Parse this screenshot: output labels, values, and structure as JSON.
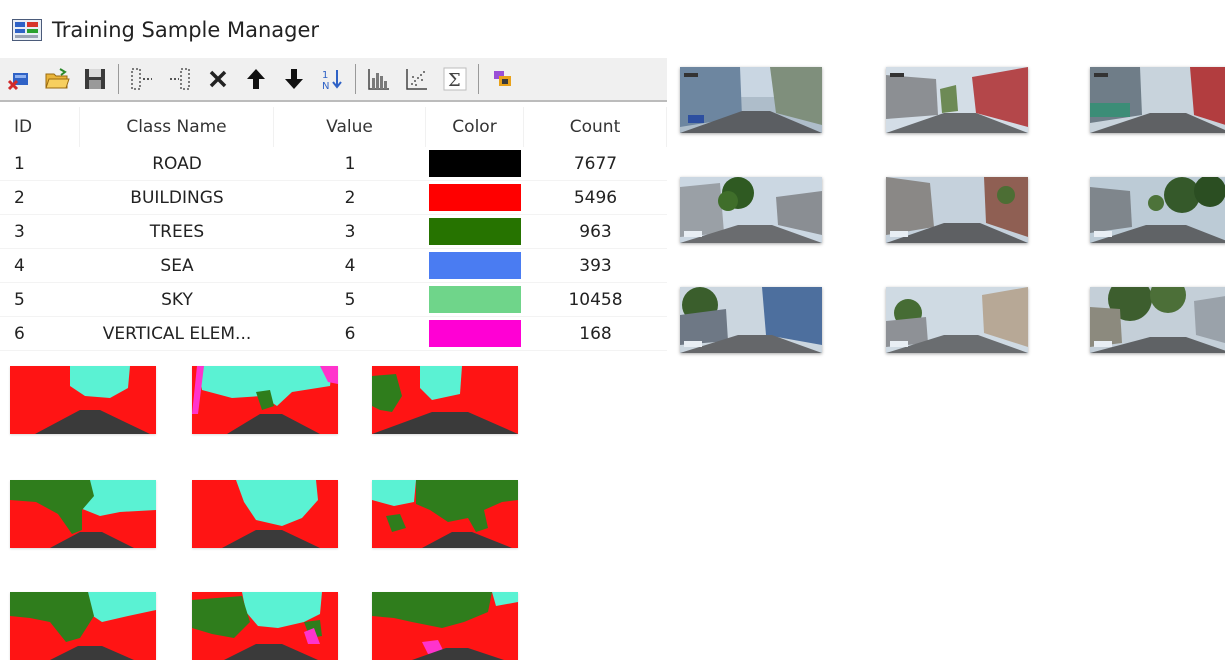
{
  "window": {
    "title": "Training Sample Manager",
    "icon": "training-sample-manager-icon"
  },
  "toolbar": {
    "buttons": [
      {
        "name": "new-class-icon"
      },
      {
        "name": "open-folder-icon"
      },
      {
        "name": "save-icon"
      },
      {
        "name": "separator"
      },
      {
        "name": "merge-classes-icon"
      },
      {
        "name": "split-class-icon"
      },
      {
        "name": "delete-icon"
      },
      {
        "name": "move-up-icon"
      },
      {
        "name": "move-down-icon"
      },
      {
        "name": "sort-icon"
      },
      {
        "name": "separator"
      },
      {
        "name": "histogram-icon"
      },
      {
        "name": "scatterplot-icon"
      },
      {
        "name": "statistics-sigma-icon"
      },
      {
        "name": "separator"
      },
      {
        "name": "export-icon"
      }
    ]
  },
  "table": {
    "columns": [
      "ID",
      "Class Name",
      "Value",
      "Color",
      "Count"
    ],
    "rows": [
      {
        "id": "1",
        "name": "ROAD",
        "value": "1",
        "color": "#000000",
        "count": "7677"
      },
      {
        "id": "2",
        "name": "BUILDINGS",
        "value": "2",
        "color": "#ff0000",
        "count": "5496"
      },
      {
        "id": "3",
        "name": "TREES",
        "value": "3",
        "color": "#267300",
        "count": "963"
      },
      {
        "id": "4",
        "name": "SEA",
        "value": "4",
        "color": "#4a7cf2",
        "count": "393"
      },
      {
        "id": "5",
        "name": "SKY",
        "value": "5",
        "color": "#6fd58a",
        "count": "10458"
      },
      {
        "id": "6",
        "name": "VERTICAL ELEM...",
        "value": "6",
        "color": "#ff00d4",
        "count": "168"
      }
    ]
  },
  "segmentation_colors": {
    "buildings": "#ff1414",
    "sky": "#5af2d3",
    "trees": "#2f7d1c",
    "road": "#3a3a3a",
    "vertical": "#ff33cc"
  }
}
